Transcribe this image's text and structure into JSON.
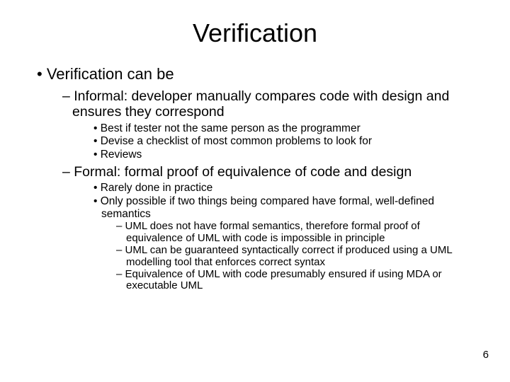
{
  "title": "Verification",
  "l1_0": "Verification can be",
  "l2_0": "Informal: developer manually compares code with design and ensures they correspond",
  "l3_0": "Best if tester not the same person as the programmer",
  "l3_1": "Devise a checklist of most common problems to look for",
  "l3_2": "Reviews",
  "l2_1": "Formal: formal proof of equivalence of code and design",
  "l3_3": "Rarely done in practice",
  "l3_4": "Only possible if two things being compared have formal, well-defined semantics",
  "l4_0": "UML does not have formal semantics, therefore formal proof of equivalence of UML with code is impossible in principle",
  "l4_1": "UML can be guaranteed syntactically correct if produced using a UML modelling tool that enforces correct syntax",
  "l4_2": "Equivalence of UML with code presumably ensured if using MDA or executable UML",
  "page_number": "6"
}
